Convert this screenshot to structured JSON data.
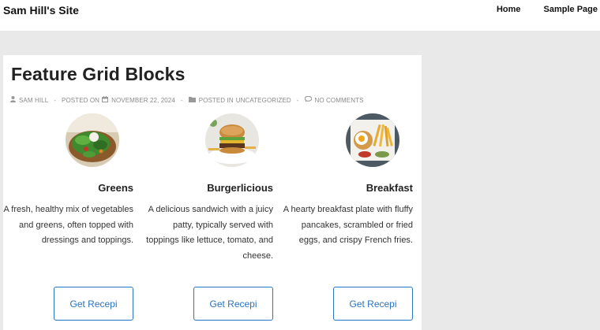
{
  "site": {
    "title": "Sam Hill's Site"
  },
  "nav": {
    "items": [
      "Home",
      "Sample Page"
    ]
  },
  "post": {
    "title": "Feature Grid Blocks",
    "meta": {
      "author": "SAM HILL",
      "posted_on_label": "POSTED ON",
      "date": "NOVEMBER 22, 2024",
      "posted_in_label": "POSTED IN",
      "category": "UNCATEGORIZED",
      "comments": "NO COMMENTS",
      "separator": "-"
    }
  },
  "features": [
    {
      "title": "Greens",
      "image_icon": "salad-image",
      "description": "A fresh, healthy mix of vegetables and greens, often topped with dressings and toppings.",
      "button": "Get Recepi"
    },
    {
      "title": "Burgerlicious",
      "image_icon": "burger-image",
      "description": "A delicious sandwich with a juicy patty, typically served with toppings like lettuce, tomato, and cheese.",
      "button": "Get Recepi"
    },
    {
      "title": "Breakfast",
      "image_icon": "breakfast-image",
      "description": "A hearty breakfast plate with fluffy pancakes, scrambled or fried eggs, and crispy French fries.",
      "button": "Get Recepi"
    }
  ],
  "colors": {
    "accent": "#2a73c0",
    "page_bg": "#e9e9e9",
    "card_bg": "#ffffff"
  }
}
